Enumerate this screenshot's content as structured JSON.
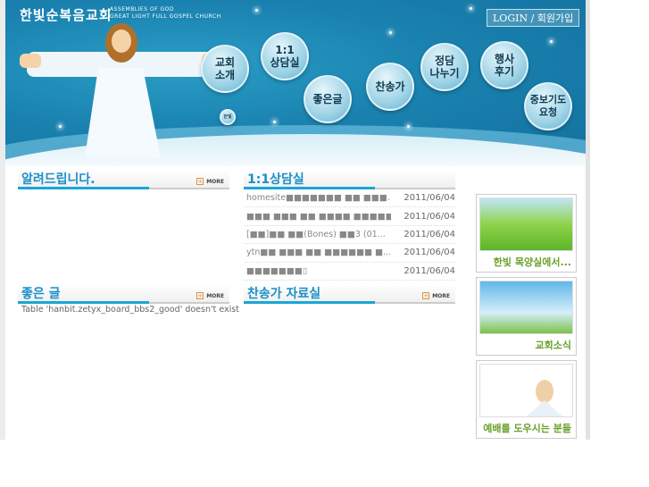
{
  "header": {
    "logo_korean": "한빛순복음교회",
    "logo_sub_line1": "ASSEMBLIES OF GOD",
    "logo_sub_line2": "GREAT LIGHT FULL GOSPEL CHURCH",
    "login_label": "LOGIN / 회원가입",
    "small_bubble": "한빛"
  },
  "nav": [
    {
      "label": "교회\n소개"
    },
    {
      "label": "1:1\n상담실"
    },
    {
      "label": "좋은글"
    },
    {
      "label": "찬송가"
    },
    {
      "label": "정담\n나누기"
    },
    {
      "label": "행사\n후기"
    },
    {
      "label": "중보기도\n요청"
    }
  ],
  "sections": {
    "notice": {
      "title": "알려드립니다.",
      "more": "MORE"
    },
    "counsel": {
      "title": "1:1상담실",
      "more": "MORE"
    },
    "good": {
      "title": "좋은 글",
      "more": "MORE",
      "error": "Table 'hanbit.zetyx_board_bbs2_good' doesn't exist"
    },
    "hymn": {
      "title": "찬송가 자료실",
      "more": "MORE"
    }
  },
  "counsel_items": [
    {
      "title": "homesite■■■■■■■ ■■ ■■■...",
      "date": "2011/06/04"
    },
    {
      "title": "■■■ ■■■ ■■ ■■■■ ■■■■■",
      "date": "2011/06/04"
    },
    {
      "title": "[■■]■■ ■■(Bones) ■■3 (01...",
      "date": "2011/06/04"
    },
    {
      "title": "ytn■■ ■■■ ■■ ■■■■■■ ■...",
      "date": "2011/06/04"
    },
    {
      "title": "■■■■■■■▯",
      "date": "2011/06/04"
    }
  ],
  "side_cards": [
    {
      "caption": "한빛 목양실에서..."
    },
    {
      "caption": "교회소식"
    },
    {
      "caption": "예배를 도우시는 분들"
    }
  ]
}
